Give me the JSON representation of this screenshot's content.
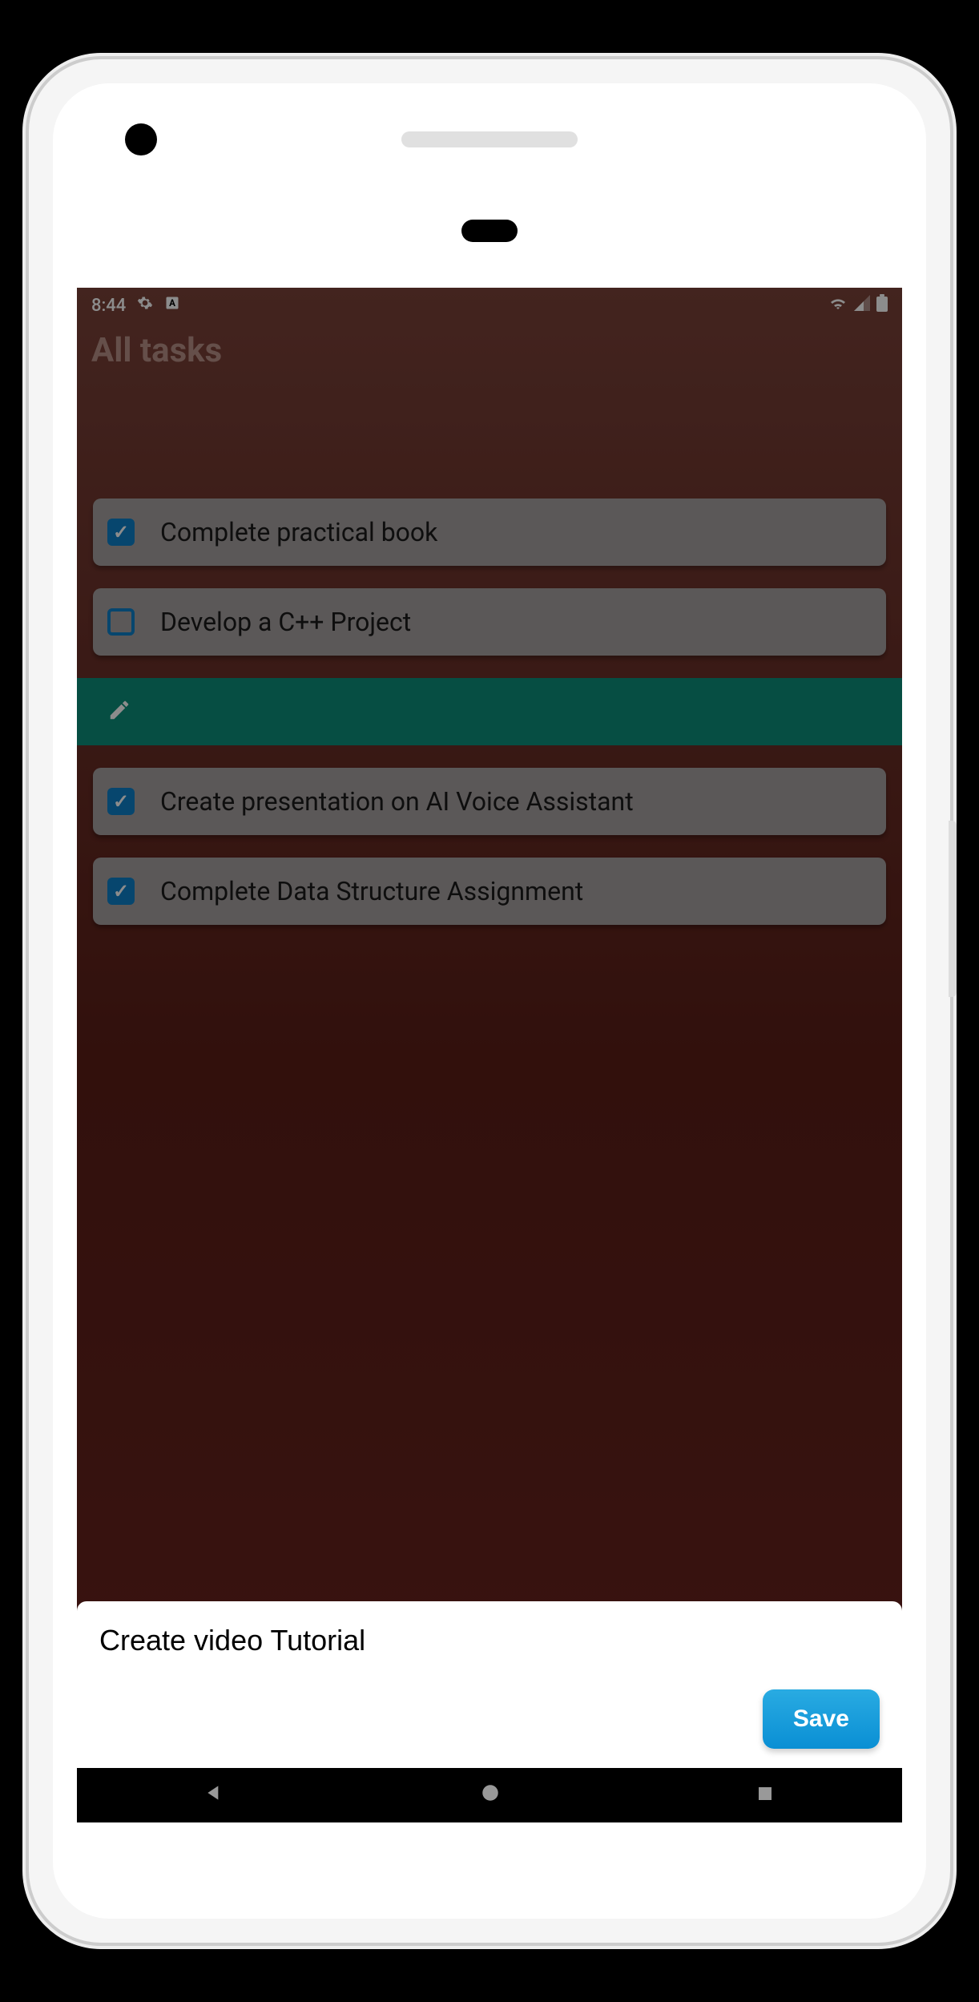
{
  "status_bar": {
    "time": "8:44",
    "icons": {
      "gear": "gear-icon",
      "language": "language-icon",
      "wifi": "wifi-icon",
      "signal": "signal-icon",
      "battery": "battery-icon"
    }
  },
  "page_title": "All tasks",
  "tasks": [
    {
      "checked": true,
      "label": "Complete practical book"
    },
    {
      "checked": false,
      "label": "Develop a C++ Project"
    },
    {
      "swiped": true
    },
    {
      "checked": true,
      "label": "Create presentation on AI Voice Assistant"
    },
    {
      "checked": true,
      "label": "Complete Data Structure Assignment"
    }
  ],
  "edit_panel": {
    "input_value": "Create video Tutorial",
    "save_label": "Save"
  },
  "colors": {
    "accent_blue": "#0d80c8",
    "swipe_teal": "#0b8e7a",
    "save_button": "#1aa0e0"
  }
}
